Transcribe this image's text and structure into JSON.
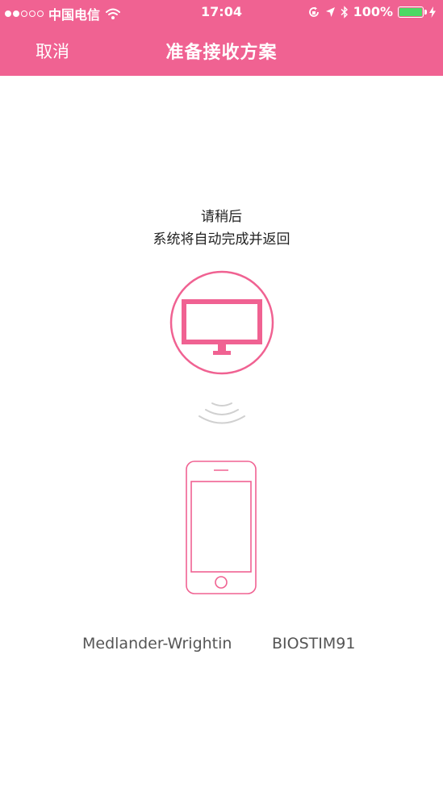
{
  "status_bar": {
    "carrier": "中国电信",
    "time": "17:04",
    "battery": "100%",
    "signal_bars_filled": 2,
    "signal_bars_total": 5,
    "icons": [
      "wifi-icon",
      "rotation-lock-icon",
      "location-arrow-icon",
      "bluetooth-icon",
      "battery-icon",
      "charging-bolt-icon"
    ]
  },
  "header": {
    "cancel_label": "取消",
    "title": "准备接收方案"
  },
  "main": {
    "message_line1": "请稍后",
    "message_line2": "系统将自动完成并返回",
    "icons": [
      "monitor-icon",
      "signal-waves-icon",
      "phone-icon"
    ]
  },
  "device": {
    "user_name": "Medlander-Wrightin",
    "device_id": "BIOSTIM91"
  },
  "colors": {
    "accent": "#f06292",
    "battery_green": "#4cd964",
    "wave_gray": "#d0d0d0",
    "text_dark": "#222222",
    "text_gray": "#555555"
  }
}
